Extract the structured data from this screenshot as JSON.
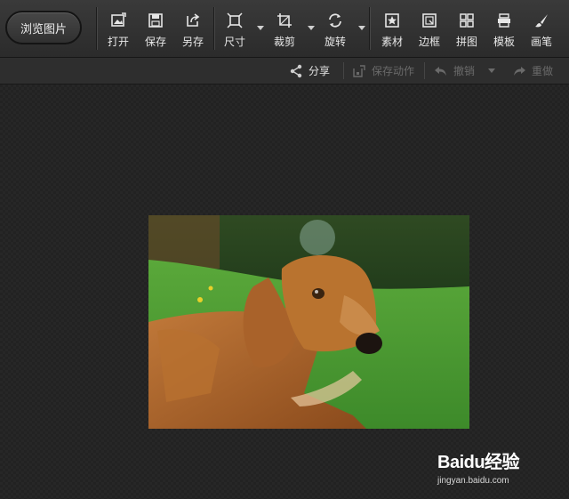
{
  "toolbar": {
    "browse_label": "浏览图片",
    "tools": [
      {
        "label": "打开",
        "icon": "open-image-icon"
      },
      {
        "label": "保存",
        "icon": "save-icon"
      },
      {
        "label": "另存",
        "icon": "save-as-icon"
      },
      {
        "label": "尺寸",
        "icon": "resize-icon"
      },
      {
        "label": "裁剪",
        "icon": "crop-icon"
      },
      {
        "label": "旋转",
        "icon": "rotate-icon"
      },
      {
        "label": "素材",
        "icon": "sticker-icon"
      },
      {
        "label": "边框",
        "icon": "frame-icon"
      },
      {
        "label": "拼图",
        "icon": "collage-icon"
      },
      {
        "label": "模板",
        "icon": "template-icon"
      },
      {
        "label": "画笔",
        "icon": "brush-icon"
      }
    ]
  },
  "subbar": {
    "share": "分享",
    "save_action": "保存动作",
    "undo": "撤销",
    "redo": "重做"
  },
  "watermark": {
    "brand": "Baidu经验",
    "url": "jingyan.baidu.com"
  },
  "colors": {
    "toolbar_bg": "#333333",
    "canvas_bg": "#222222",
    "text": "#e6e6e6",
    "disabled": "#6a6a6a"
  }
}
